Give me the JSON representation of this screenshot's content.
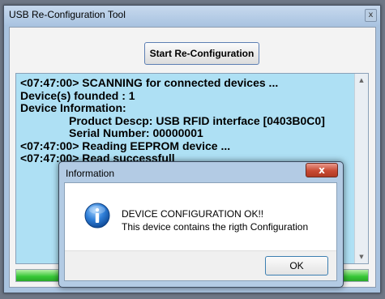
{
  "window": {
    "title": "USB Re-Configuration Tool",
    "close_glyph": "x"
  },
  "toolbar": {
    "start_label": "Start Re-Configuration"
  },
  "log": {
    "lines": [
      {
        "text": "<07:47:00> SCANNING for connected devices ...",
        "indent": false
      },
      {
        "text": "Device(s) founded : 1",
        "indent": false
      },
      {
        "text": "Device Information:",
        "indent": false
      },
      {
        "text": "Product Descp: USB RFID interface [0403B0C0]",
        "indent": true
      },
      {
        "text": "Serial Number: 00000001",
        "indent": true
      },
      {
        "text": "<07:47:00> Reading EEPROM device ...",
        "indent": false
      },
      {
        "text": "<07:47:00> Read successfull",
        "indent": false
      }
    ],
    "background": "#aee0f4"
  },
  "progress": {
    "percent": 100,
    "color": "#35c735"
  },
  "dialog": {
    "title": "Information",
    "close_glyph": "x",
    "message": "DEVICE CONFIGURATION OK!!",
    "detail": "This device contains the rigth Configuration",
    "ok_label": "OK",
    "icon": "info-icon",
    "close_color": "#c84a33"
  }
}
